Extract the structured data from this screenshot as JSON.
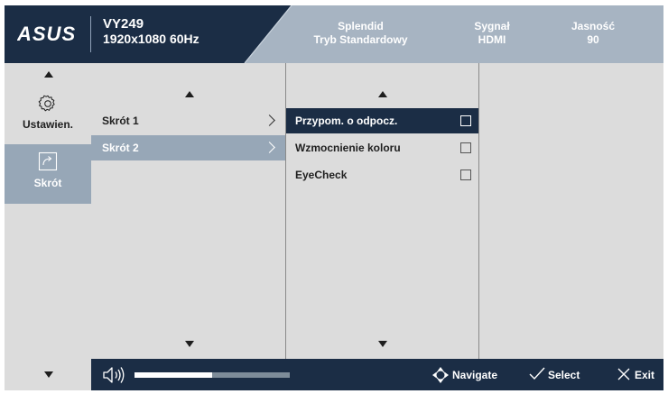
{
  "header": {
    "logo_text": "ASUS",
    "model": "VY249",
    "resolution": "1920x1080 60Hz",
    "stats": [
      {
        "label": "Splendid",
        "value": "Tryb Standardowy"
      },
      {
        "label": "Sygnał",
        "value": "HDMI"
      },
      {
        "label": "Jasność",
        "value": "90"
      }
    ],
    "colors": {
      "dark": "#1b2d45",
      "light": "#a7b4c2"
    }
  },
  "nav": {
    "items": [
      {
        "label": "Ustawien.",
        "icon": "gear-icon",
        "active": false
      },
      {
        "label": "Skrót",
        "icon": "shortcut-icon",
        "active": true
      }
    ]
  },
  "level1": {
    "items": [
      {
        "label": "Skrót 1",
        "selected": false
      },
      {
        "label": "Skrót 2",
        "selected": true
      }
    ]
  },
  "level2": {
    "items": [
      {
        "label": "Przypom. o odpocz.",
        "checked": false,
        "focused": true
      },
      {
        "label": "Wzmocnienie koloru",
        "checked": false,
        "focused": false
      },
      {
        "label": "EyeCheck",
        "checked": false,
        "focused": false
      }
    ]
  },
  "footer": {
    "volume_level": 0.5,
    "navigate_label": "Navigate",
    "select_label": "Select",
    "exit_label": "Exit"
  }
}
